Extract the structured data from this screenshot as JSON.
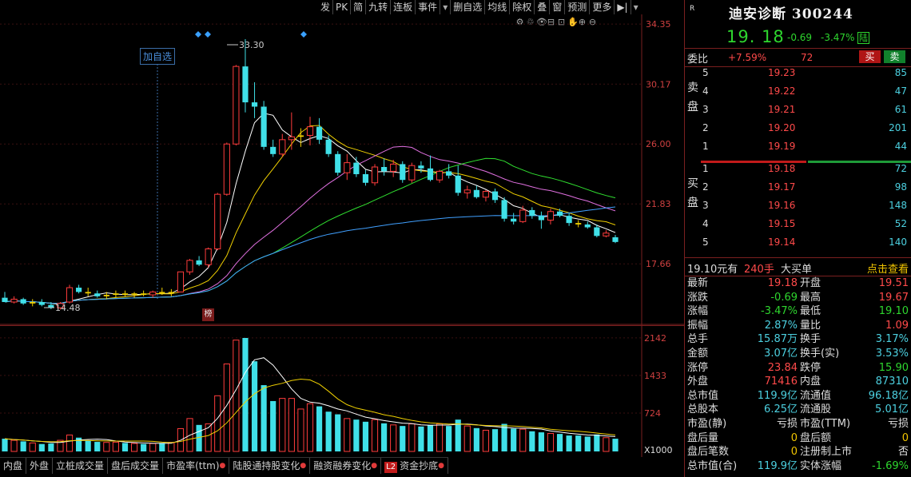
{
  "toolbar": [
    "发",
    "PK",
    "简",
    "九转",
    "连板",
    "事件",
    "▾",
    "删自选",
    "均线",
    "除权",
    "叠",
    "窗",
    "预测",
    "更多",
    "▶|",
    "▾"
  ],
  "chart_icons": [
    "⚙",
    "♲",
    "👁",
    "⊟",
    "⊡",
    "✋",
    "⊕",
    "⊖"
  ],
  "main_labels": {
    "add_watch": "加自选",
    "high_mark": "33.30",
    "low_mark": "14.48",
    "bang": "榜"
  },
  "price_axis": [
    "34.35",
    "30.17",
    "26.00",
    "21.83",
    "17.66"
  ],
  "volume_axis": [
    "2142",
    "1433",
    "724",
    "X1000"
  ],
  "bottom_tabs": [
    "内盘",
    "外盘",
    "立桩成交量",
    "盘后成交量",
    "市盈率(ttm)",
    "陆股通持股变化",
    "融资融券变化",
    "资金抄底"
  ],
  "bottom_tab_l2": "L2",
  "header": {
    "r_mark": "R",
    "name": "迪安诊断 300244",
    "price": "19. 18",
    "change": "-0.69",
    "change_pct": "-3.47%",
    "market_tag": "陆"
  },
  "ratio": {
    "label": "委比",
    "pct": "+7.59%",
    "value": "72",
    "buy": "买",
    "sell": "卖"
  },
  "sell_side_label": "卖盘",
  "buy_side_label": "买盘",
  "order_book": {
    "sell": [
      {
        "level": "5",
        "price": "19.23",
        "qty": "85"
      },
      {
        "level": "4",
        "price": "19.22",
        "qty": "47"
      },
      {
        "level": "3",
        "price": "19.21",
        "qty": "61"
      },
      {
        "level": "2",
        "price": "19.20",
        "qty": "201"
      },
      {
        "level": "1",
        "price": "19.19",
        "qty": "44"
      }
    ],
    "buy": [
      {
        "level": "1",
        "price": "19.18",
        "qty": "72"
      },
      {
        "level": "2",
        "price": "19.17",
        "qty": "98"
      },
      {
        "level": "3",
        "price": "19.16",
        "qty": "148"
      },
      {
        "level": "4",
        "price": "19.15",
        "qty": "52"
      },
      {
        "level": "5",
        "price": "19.14",
        "qty": "140"
      }
    ]
  },
  "big_order": {
    "a": "19.10元有",
    "b": "240手",
    "c": "大买单",
    "d": "点击查看"
  },
  "quote": [
    {
      "k1": "最新",
      "v1": "19.18",
      "c1": "red",
      "k2": "开盘",
      "v2": "19.51",
      "c2": "red"
    },
    {
      "k1": "涨跌",
      "v1": "-0.69",
      "c1": "green",
      "k2": "最高",
      "v2": "19.67",
      "c2": "red"
    },
    {
      "k1": "涨幅",
      "v1": "-3.47%",
      "c1": "green",
      "k2": "最低",
      "v2": "19.10",
      "c2": "green"
    },
    {
      "k1": "振幅",
      "v1": "2.87%",
      "c1": "cyan",
      "k2": "量比",
      "v2": "1.09",
      "c2": "red"
    },
    {
      "k1": "总手",
      "v1": "15.87万",
      "c1": "cyan",
      "k2": "换手",
      "v2": "3.17%",
      "c2": "cyan"
    },
    {
      "k1": "金额",
      "v1": "3.07亿",
      "c1": "cyan",
      "k2": "换手(实)",
      "v2": "3.53%",
      "c2": "cyan"
    },
    {
      "k1": "涨停",
      "v1": "23.84",
      "c1": "red",
      "k2": "跌停",
      "v2": "15.90",
      "c2": "green"
    },
    {
      "k1": "外盘",
      "v1": "71416",
      "c1": "red",
      "k2": "内盘",
      "v2": "87310",
      "c2": "cyan"
    },
    {
      "k1": "总市值",
      "v1": "119.9亿",
      "c1": "cyan",
      "k2": "流通值",
      "v2": "96.18亿",
      "c2": "cyan"
    },
    {
      "k1": "总股本",
      "v1": "6.25亿",
      "c1": "cyan",
      "k2": "流通股",
      "v2": "5.01亿",
      "c2": "cyan"
    },
    {
      "k1": "市盈(静)",
      "v1": "亏损",
      "c1": "white",
      "k2": "市盈(TTM)",
      "v2": "亏损",
      "c2": "white"
    },
    {
      "k1": "盘后量",
      "v1": "0",
      "c1": "yellow",
      "k2": "盘后额",
      "v2": "0",
      "c2": "yellow"
    },
    {
      "k1": "盘后笔数",
      "v1": "0",
      "c1": "yellow",
      "k2": "注册制上市",
      "v2": "否",
      "c2": "white"
    },
    {
      "k1": "总市值(合)",
      "v1": "119.9亿",
      "c1": "cyan",
      "k2": "实体涨幅",
      "v2": "-1.69%",
      "c2": "green"
    }
  ],
  "colors": {
    "up": "#ff3c3c",
    "down": "#40e0e8",
    "ma5": "#ffffff",
    "ma10": "#f0d000",
    "ma20": "#e070e0",
    "ma30": "#30e030",
    "ma60": "#40a0ff"
  },
  "chart_data": {
    "type": "candlestick",
    "price_ylim": [
      14.0,
      34.8
    ],
    "volume_ylim": [
      0,
      2200
    ],
    "candles": [
      [
        15.3,
        15.7,
        15.1,
        15.0,
        0,
        240
      ],
      [
        15.0,
        15.4,
        14.9,
        15.2,
        0,
        210
      ],
      [
        15.2,
        15.3,
        14.8,
        14.9,
        0,
        190
      ],
      [
        14.9,
        15.2,
        14.7,
        15.0,
        0,
        160
      ],
      [
        15.0,
        15.2,
        14.7,
        14.8,
        0,
        140
      ],
      [
        14.8,
        15.0,
        14.5,
        14.6,
        0,
        150
      ],
      [
        14.6,
        15.0,
        14.48,
        14.9,
        0,
        210
      ],
      [
        15.0,
        16.2,
        14.9,
        16.0,
        0,
        310
      ],
      [
        16.0,
        16.2,
        15.6,
        15.7,
        0,
        260
      ],
      [
        15.7,
        16.0,
        15.4,
        15.6,
        0,
        200
      ],
      [
        15.6,
        15.8,
        15.3,
        15.4,
        0,
        180
      ],
      [
        15.4,
        15.7,
        15.2,
        15.5,
        0,
        170
      ],
      [
        15.5,
        15.8,
        15.3,
        15.6,
        0,
        175
      ],
      [
        15.6,
        15.8,
        15.4,
        15.5,
        0,
        160
      ],
      [
        15.5,
        15.7,
        15.3,
        15.6,
        0,
        150
      ],
      [
        15.6,
        15.8,
        15.4,
        15.5,
        0,
        140
      ],
      [
        15.5,
        15.8,
        15.3,
        15.7,
        0,
        150
      ],
      [
        15.7,
        16.0,
        15.5,
        15.6,
        0,
        160
      ],
      [
        15.6,
        15.9,
        15.4,
        15.7,
        0,
        170
      ],
      [
        15.7,
        17.1,
        15.7,
        17.1,
        0,
        430
      ],
      [
        17.1,
        18.0,
        16.9,
        17.9,
        0,
        620
      ],
      [
        17.9,
        18.2,
        17.5,
        17.6,
        0,
        500
      ],
      [
        17.6,
        18.8,
        17.4,
        18.7,
        0,
        520
      ],
      [
        18.7,
        22.6,
        18.6,
        22.5,
        0,
        1050
      ],
      [
        22.5,
        26.1,
        22.4,
        26.0,
        0,
        1650
      ],
      [
        26.0,
        31.5,
        25.9,
        31.4,
        0,
        2100
      ],
      [
        31.4,
        33.3,
        28.2,
        28.9,
        1,
        2140
      ],
      [
        28.9,
        30.3,
        27.8,
        28.6,
        0,
        1700
      ],
      [
        28.6,
        29.0,
        25.6,
        25.8,
        1,
        1250
      ],
      [
        25.8,
        26.3,
        25.1,
        25.3,
        1,
        950
      ],
      [
        25.3,
        26.7,
        25.1,
        26.3,
        0,
        1000
      ],
      [
        26.3,
        28.2,
        25.6,
        26.5,
        0,
        1000
      ],
      [
        26.5,
        27.1,
        25.8,
        26.6,
        0,
        800
      ],
      [
        26.6,
        27.9,
        25.9,
        27.2,
        0,
        900
      ],
      [
        27.2,
        27.8,
        26.0,
        26.3,
        1,
        850
      ],
      [
        26.3,
        26.6,
        25.1,
        25.3,
        1,
        750
      ],
      [
        25.3,
        25.5,
        23.8,
        24.0,
        1,
        700
      ],
      [
        24.0,
        25.3,
        23.5,
        24.7,
        0,
        620
      ],
      [
        24.7,
        25.1,
        23.7,
        23.9,
        1,
        600
      ],
      [
        23.9,
        24.2,
        23.1,
        23.3,
        1,
        560
      ],
      [
        23.3,
        24.6,
        23.1,
        24.4,
        0,
        600
      ],
      [
        24.4,
        25.0,
        23.8,
        24.1,
        1,
        530
      ],
      [
        24.1,
        24.9,
        23.7,
        24.6,
        0,
        500
      ],
      [
        24.6,
        24.8,
        23.3,
        23.5,
        1,
        480
      ],
      [
        23.5,
        24.7,
        23.3,
        24.5,
        0,
        520
      ],
      [
        24.5,
        24.8,
        24.0,
        24.3,
        1,
        470
      ],
      [
        24.3,
        25.2,
        23.4,
        23.5,
        1,
        500
      ],
      [
        23.5,
        24.2,
        23.3,
        24.1,
        0,
        520
      ],
      [
        24.1,
        24.6,
        23.6,
        23.8,
        1,
        480
      ],
      [
        23.8,
        24.5,
        22.4,
        22.6,
        1,
        600
      ],
      [
        22.6,
        23.1,
        22.2,
        22.8,
        0,
        480
      ],
      [
        22.8,
        23.1,
        22.2,
        22.3,
        1,
        440
      ],
      [
        22.3,
        22.8,
        22.0,
        22.7,
        0,
        400
      ],
      [
        22.7,
        22.9,
        21.9,
        22.1,
        1,
        420
      ],
      [
        22.1,
        22.3,
        20.6,
        20.8,
        1,
        520
      ],
      [
        20.8,
        21.2,
        20.4,
        20.6,
        1,
        430
      ],
      [
        20.6,
        21.7,
        20.5,
        21.4,
        0,
        420
      ],
      [
        21.4,
        21.6,
        20.8,
        21.0,
        1,
        380
      ],
      [
        21.0,
        21.3,
        20.1,
        20.7,
        1,
        360
      ],
      [
        20.7,
        21.5,
        20.4,
        21.3,
        0,
        340
      ],
      [
        21.3,
        21.5,
        20.9,
        21.0,
        1,
        330
      ],
      [
        21.0,
        21.2,
        20.3,
        20.5,
        1,
        300
      ],
      [
        20.5,
        20.7,
        20.2,
        20.4,
        1,
        300
      ],
      [
        20.4,
        20.6,
        20.1,
        20.2,
        1,
        280
      ],
      [
        20.2,
        20.4,
        19.5,
        19.6,
        1,
        320
      ],
      [
        19.6,
        20.0,
        19.5,
        19.8,
        0,
        260
      ],
      [
        19.51,
        19.67,
        19.1,
        19.18,
        1,
        240
      ]
    ],
    "series": [
      {
        "name": "MA5"
      },
      {
        "name": "MA10"
      },
      {
        "name": "MA20"
      },
      {
        "name": "MA30"
      },
      {
        "name": "MA60"
      }
    ]
  }
}
